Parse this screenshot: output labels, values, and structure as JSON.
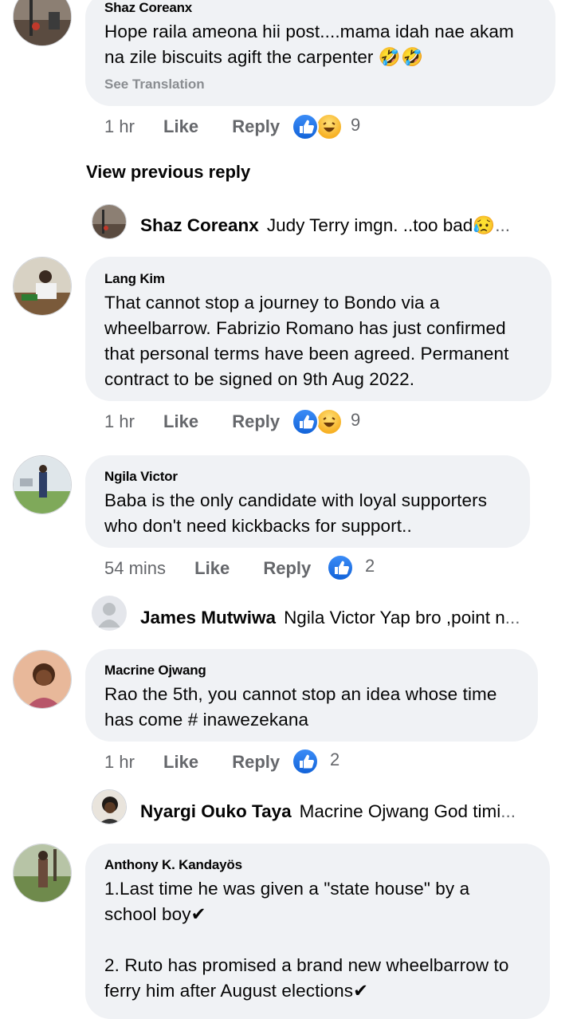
{
  "comments": [
    {
      "author": "Shaz Coreanx",
      "text_lines": [
        "Hope raila ameona hii post....mama idah nae akam",
        "na zile biscuits agift the carpenter 🤣🤣"
      ],
      "see_translation": "See Translation",
      "time": "1 hr",
      "like": "Like",
      "reply": "Reply",
      "reactions": [
        "like",
        "haha"
      ],
      "reaction_count": "9"
    },
    {
      "author": "Lang Kim",
      "text_lines": [
        "That cannot stop a journey to Bondo via a",
        "wheelbarrow. Fabrizio Romano has just confirmed",
        "that personal terms have been agreed. Permanent",
        "contract to be signed on 9th Aug 2022."
      ],
      "time": "1 hr",
      "like": "Like",
      "reply": "Reply",
      "reactions": [
        "like",
        "haha"
      ],
      "reaction_count": "9"
    },
    {
      "author": "Ngila Victor",
      "text_lines": [
        "Baba is the only candidate with loyal supporters",
        "who don't need kickbacks for support.."
      ],
      "time": "54 mins",
      "like": "Like",
      "reply": "Reply",
      "reactions": [
        "like"
      ],
      "reaction_count": "2"
    },
    {
      "author": "Macrine Ojwang",
      "text_lines": [
        "Rao the 5th, you cannot stop an idea whose time",
        "has come # inawezekana"
      ],
      "time": "1 hr",
      "like": "Like",
      "reply": "Reply",
      "reactions": [
        "like"
      ],
      "reaction_count": "2"
    },
    {
      "author": "Anthony K. Kandayös",
      "text_lines": [
        "1.Last time he was given a \"state house\" by a",
        "school boy✔",
        "",
        "2. Ruto has promised a brand new wheelbarrow to",
        "ferry him after August elections✔"
      ]
    }
  ],
  "view_previous_reply": "View previous reply",
  "replies": [
    {
      "author": "Shaz Coreanx",
      "preview": "Judy Terry imgn. ..too bad😥",
      "ellipsis": "..."
    },
    {
      "author": "James Mutwiwa",
      "preview": "Ngila Victor Yap bro ,point n",
      "ellipsis": "..."
    },
    {
      "author": "Nyargi Ouko Taya",
      "preview": "Macrine Ojwang God timi",
      "ellipsis": "..."
    }
  ],
  "icons": {
    "like": "thumbs-up-icon",
    "haha": "laughing-face-icon",
    "check": "check-mark-icon"
  },
  "colors": {
    "bubble": "#f0f2f5",
    "meta_text": "#65676b",
    "like_blue": "#1877f2"
  }
}
